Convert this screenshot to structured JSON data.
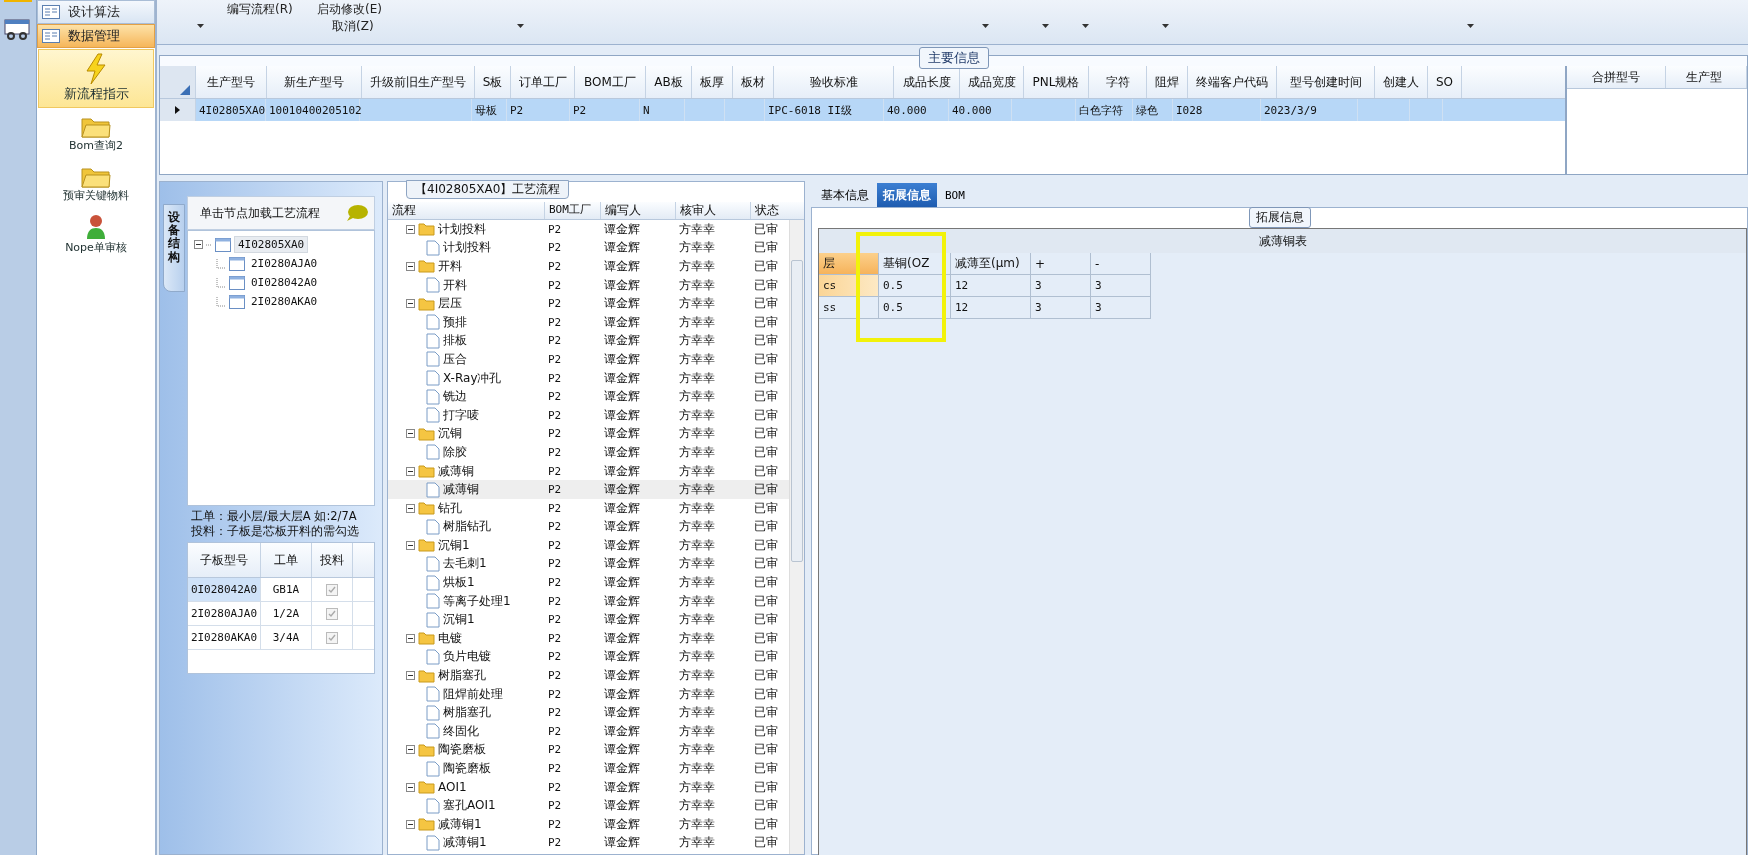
{
  "toolbar": {
    "items": [
      {
        "label": "编写流程(R)"
      },
      {
        "label": "启动修改(E)"
      },
      {
        "label": "取消(Z)"
      }
    ]
  },
  "nav": {
    "sections": [
      {
        "label": "设计算法",
        "selected": false
      },
      {
        "label": "数据管理",
        "selected": true
      }
    ],
    "items": [
      {
        "label": "新流程指示",
        "kind": "bolt",
        "selected": true
      },
      {
        "label": "Bom查询2",
        "kind": "folder",
        "selected": false
      },
      {
        "label": "预审关键物料",
        "kind": "folder",
        "selected": false
      },
      {
        "label": "Nope单审核",
        "kind": "person",
        "selected": false
      }
    ]
  },
  "main_info": {
    "title": "主要信息",
    "columns": [
      "生产型号",
      "新生产型号",
      "升级前旧生产型号",
      "S板",
      "订单工厂",
      "BOM工厂",
      "AB板",
      "板厚",
      "板材",
      "验收标准",
      "成品长度",
      "成品宽度",
      "PNL规格",
      "字符",
      "阻焊",
      "终端客户代码",
      "型号创建时间",
      "创建人",
      "SO"
    ],
    "rows": [
      {
        "selected": true,
        "cells": [
          "4I02805XA0",
          "10010400205102",
          "",
          "母板",
          "P2",
          "P2",
          "N",
          "",
          "",
          "IPC-6018 II级",
          "40.000",
          "40.000",
          "",
          "白色字符",
          "绿色",
          "I028",
          "2023/3/9",
          "",
          ""
        ]
      }
    ]
  },
  "merge_table": {
    "columns": [
      "合拼型号",
      "生产型"
    ]
  },
  "structure": {
    "tab": "设备结构",
    "hint": "单击节点加载工艺流程",
    "tree": [
      {
        "label": "4I02805XA0",
        "selected": true,
        "expanded": true,
        "children": [
          {
            "label": "2I0280AJA0",
            "selected": false
          },
          {
            "label": "0I028042A0",
            "selected": false
          },
          {
            "label": "2I0280AKA0",
            "selected": false
          }
        ]
      }
    ],
    "notes": [
      "工单：最小层/最大层A 如:2/7A",
      "投料：子板是芯板开料的需勾选"
    ],
    "sub_table": {
      "columns": [
        "子板型号",
        "工单",
        "投料"
      ],
      "rows": [
        {
          "model": "0I028042A0",
          "order": "GB1A",
          "feed": true,
          "selected": true
        },
        {
          "model": "2I0280AJA0",
          "order": "1/2A",
          "feed": true,
          "selected": false
        },
        {
          "model": "2I0280AKA0",
          "order": "3/4A",
          "feed": true,
          "selected": false
        }
      ]
    }
  },
  "flow": {
    "title": "【4I02805XA0】工艺流程",
    "columns": [
      "流程",
      "BOM工厂",
      "编写人",
      "核审人",
      "状态"
    ],
    "rows": [
      {
        "name": "计划投料",
        "bom": "P2",
        "writer": "谭金辉",
        "reviewer": "方幸幸",
        "status": "已审",
        "selected": false,
        "expanded": true,
        "children": [
          {
            "name": "计划投料",
            "bom": "P2",
            "writer": "谭金辉",
            "reviewer": "方幸幸",
            "status": "已审",
            "selected": false
          }
        ]
      },
      {
        "name": "开料",
        "bom": "P2",
        "writer": "谭金辉",
        "reviewer": "方幸幸",
        "status": "已审",
        "selected": false,
        "expanded": true,
        "children": [
          {
            "name": "开料",
            "bom": "P2",
            "writer": "谭金辉",
            "reviewer": "方幸幸",
            "status": "已审",
            "selected": false
          }
        ]
      },
      {
        "name": "层压",
        "bom": "P2",
        "writer": "谭金辉",
        "reviewer": "方幸幸",
        "status": "已审",
        "selected": false,
        "expanded": true,
        "children": [
          {
            "name": "预排",
            "bom": "P2",
            "writer": "谭金辉",
            "reviewer": "方幸幸",
            "status": "已审",
            "selected": false
          },
          {
            "name": "排板",
            "bom": "P2",
            "writer": "谭金辉",
            "reviewer": "方幸幸",
            "status": "已审",
            "selected": false
          },
          {
            "name": "压合",
            "bom": "P2",
            "writer": "谭金辉",
            "reviewer": "方幸幸",
            "status": "已审",
            "selected": false
          },
          {
            "name": "X-Ray冲孔",
            "bom": "P2",
            "writer": "谭金辉",
            "reviewer": "方幸幸",
            "status": "已审",
            "selected": false
          },
          {
            "name": "铣边",
            "bom": "P2",
            "writer": "谭金辉",
            "reviewer": "方幸幸",
            "status": "已审",
            "selected": false
          },
          {
            "name": "打字唛",
            "bom": "P2",
            "writer": "谭金辉",
            "reviewer": "方幸幸",
            "status": "已审",
            "selected": false
          }
        ]
      },
      {
        "name": "沉铜",
        "bom": "P2",
        "writer": "谭金辉",
        "reviewer": "方幸幸",
        "status": "已审",
        "selected": false,
        "expanded": true,
        "children": [
          {
            "name": "除胶",
            "bom": "P2",
            "writer": "谭金辉",
            "reviewer": "方幸幸",
            "status": "已审",
            "selected": false
          }
        ]
      },
      {
        "name": "减薄铜",
        "bom": "P2",
        "writer": "谭金辉",
        "reviewer": "方幸幸",
        "status": "已审",
        "selected": false,
        "expanded": true,
        "children": [
          {
            "name": "减薄铜",
            "bom": "P2",
            "writer": "谭金辉",
            "reviewer": "方幸幸",
            "status": "已审",
            "selected": true
          }
        ]
      },
      {
        "name": "钻孔",
        "bom": "P2",
        "writer": "谭金辉",
        "reviewer": "方幸幸",
        "status": "已审",
        "selected": false,
        "expanded": true,
        "children": [
          {
            "name": "树脂钻孔",
            "bom": "P2",
            "writer": "谭金辉",
            "reviewer": "方幸幸",
            "status": "已审",
            "selected": false
          }
        ]
      },
      {
        "name": "沉铜1",
        "bom": "P2",
        "writer": "谭金辉",
        "reviewer": "方幸幸",
        "status": "已审",
        "selected": false,
        "expanded": true,
        "children": [
          {
            "name": "去毛刺1",
            "bom": "P2",
            "writer": "谭金辉",
            "reviewer": "方幸幸",
            "status": "已审",
            "selected": false
          },
          {
            "name": "烘板1",
            "bom": "P2",
            "writer": "谭金辉",
            "reviewer": "方幸幸",
            "status": "已审",
            "selected": false
          },
          {
            "name": "等离子处理1",
            "bom": "P2",
            "writer": "谭金辉",
            "reviewer": "方幸幸",
            "status": "已审",
            "selected": false
          },
          {
            "name": "沉铜1",
            "bom": "P2",
            "writer": "谭金辉",
            "reviewer": "方幸幸",
            "status": "已审",
            "selected": false
          }
        ]
      },
      {
        "name": "电镀",
        "bom": "P2",
        "writer": "谭金辉",
        "reviewer": "方幸幸",
        "status": "已审",
        "selected": false,
        "expanded": true,
        "children": [
          {
            "name": "负片电镀",
            "bom": "P2",
            "writer": "谭金辉",
            "reviewer": "方幸幸",
            "status": "已审",
            "selected": false
          }
        ]
      },
      {
        "name": "树脂塞孔",
        "bom": "P2",
        "writer": "谭金辉",
        "reviewer": "方幸幸",
        "status": "已审",
        "selected": false,
        "expanded": true,
        "children": [
          {
            "name": "阻焊前处理",
            "bom": "P2",
            "writer": "谭金辉",
            "reviewer": "方幸幸",
            "status": "已审",
            "selected": false
          },
          {
            "name": "树脂塞孔",
            "bom": "P2",
            "writer": "谭金辉",
            "reviewer": "方幸幸",
            "status": "已审",
            "selected": false
          },
          {
            "name": "终固化",
            "bom": "P2",
            "writer": "谭金辉",
            "reviewer": "方幸幸",
            "status": "已审",
            "selected": false
          }
        ]
      },
      {
        "name": "陶瓷磨板",
        "bom": "P2",
        "writer": "谭金辉",
        "reviewer": "方幸幸",
        "status": "已审",
        "selected": false,
        "expanded": true,
        "children": [
          {
            "name": "陶瓷磨板",
            "bom": "P2",
            "writer": "谭金辉",
            "reviewer": "方幸幸",
            "status": "已审",
            "selected": false
          }
        ]
      },
      {
        "name": "AOI1",
        "bom": "P2",
        "writer": "谭金辉",
        "reviewer": "方幸幸",
        "status": "已审",
        "selected": false,
        "expanded": true,
        "children": [
          {
            "name": "塞孔AOI1",
            "bom": "P2",
            "writer": "谭金辉",
            "reviewer": "方幸幸",
            "status": "已审",
            "selected": false
          }
        ]
      },
      {
        "name": "减薄铜1",
        "bom": "P2",
        "writer": "谭金辉",
        "reviewer": "方幸幸",
        "status": "已审",
        "selected": false,
        "expanded": true,
        "children": [
          {
            "name": "减薄铜1",
            "bom": "P2",
            "writer": "谭金辉",
            "reviewer": "方幸幸",
            "status": "已审",
            "selected": false
          }
        ]
      }
    ]
  },
  "detail": {
    "tabs": [
      {
        "label": "基本信息",
        "selected": false
      },
      {
        "label": "拓展信息",
        "selected": true
      },
      {
        "label": "BOM",
        "selected": false
      }
    ],
    "group_title": "拓展信息",
    "table": {
      "title": "减薄铜表",
      "columns": [
        "层",
        "基铜(OZ",
        "减薄至(μm)",
        "+",
        "-"
      ],
      "rows": [
        {
          "selected": true,
          "cells": [
            "cs",
            "0.5",
            "12",
            "3",
            "3"
          ]
        },
        {
          "selected": false,
          "cells": [
            "ss",
            "0.5",
            "12",
            "3",
            "3"
          ]
        }
      ]
    }
  }
}
